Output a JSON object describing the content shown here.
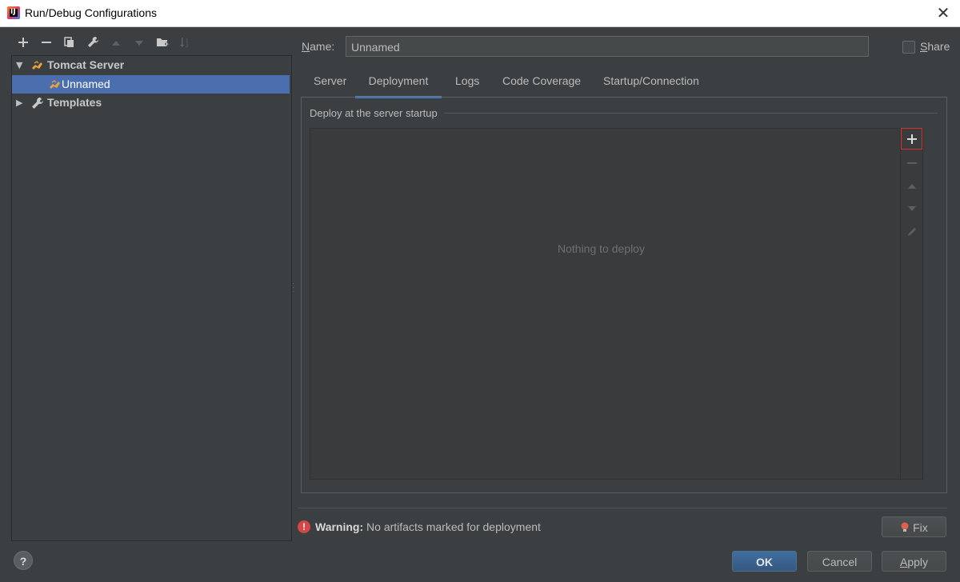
{
  "window": {
    "title": "Run/Debug Configurations"
  },
  "toolbar": {
    "buttons": [
      "add",
      "remove",
      "copy",
      "edit-defaults",
      "move-up",
      "move-down",
      "folder",
      "sort"
    ]
  },
  "tree": {
    "group": {
      "label": "Tomcat Server",
      "expanded": true
    },
    "selected_item": {
      "label": "Unnamed"
    },
    "templates": {
      "label": "Templates",
      "expanded": false
    }
  },
  "form": {
    "name_label": "Name:",
    "name_label_mnemonic": "N",
    "name_label_rest": "ame:",
    "name_value": "Unnamed",
    "share_label": "Share",
    "share_mnemonic": "S",
    "share_rest": "hare",
    "share_checked": false
  },
  "tabs": [
    {
      "label": "Server",
      "active": false
    },
    {
      "label": "Deployment",
      "active": true
    },
    {
      "label": "Logs",
      "active": false
    },
    {
      "label": "Code Coverage",
      "active": false
    },
    {
      "label": "Startup/Connection",
      "active": false
    }
  ],
  "deployment": {
    "group_title": "Deploy at the server startup",
    "empty_text": "Nothing to deploy"
  },
  "warning": {
    "prefix": "Warning:",
    "message": "No artifacts marked for deployment",
    "fix_label": "Fix"
  },
  "footer": {
    "ok_label": "OK",
    "cancel_label": "Cancel",
    "apply_label": "Apply",
    "apply_mnemonic": "A",
    "apply_rest": "pply",
    "help_label": "?"
  },
  "colors": {
    "background": "#3c3f41",
    "selection": "#4b6eaf",
    "accent_tab": "#4a88c7",
    "highlight_border": "#d9322c",
    "warning": "#d34746",
    "primary_button": "#365880"
  }
}
